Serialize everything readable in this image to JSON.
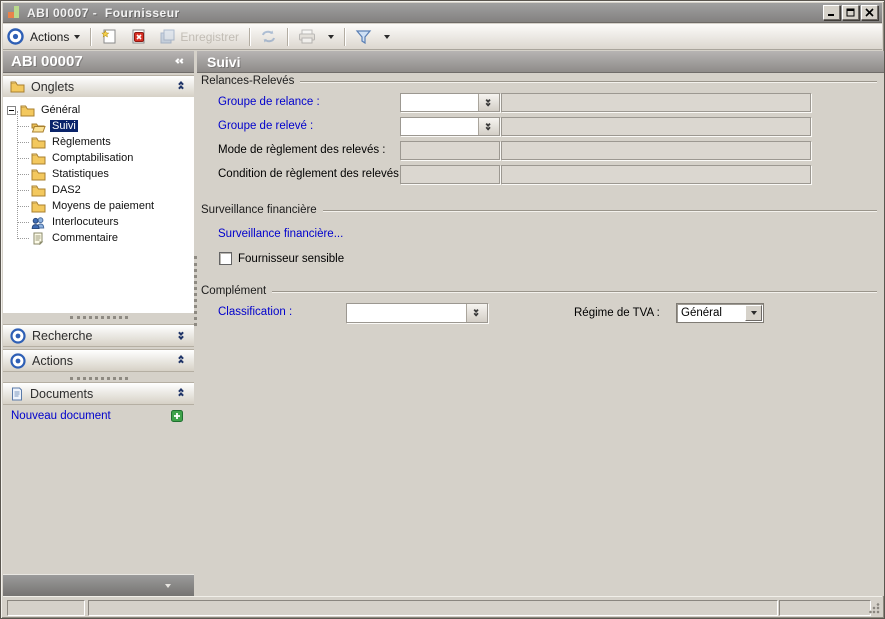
{
  "window": {
    "title": "ABI 00007 -  Fournisseur"
  },
  "toolbar": {
    "actions_label": "Actions",
    "save_label": "Enregistrer"
  },
  "sidebar": {
    "header": "ABI 00007",
    "sections": {
      "onglets": "Onglets",
      "recherche": "Recherche",
      "actions": "Actions",
      "documents": "Documents"
    },
    "tree": {
      "root": "Général",
      "items": [
        {
          "label": "Suivi",
          "selected": true
        },
        {
          "label": "Règlements"
        },
        {
          "label": "Comptabilisation"
        },
        {
          "label": "Statistiques"
        },
        {
          "label": "DAS2"
        },
        {
          "label": "Moyens de paiement"
        },
        {
          "label": "Interlocuteurs"
        },
        {
          "label": "Commentaire"
        }
      ]
    },
    "nouveau_document": "Nouveau document"
  },
  "main": {
    "title": "Suivi",
    "relances": {
      "title": "Relances-Relevés",
      "fields": [
        {
          "label": "Groupe de relance :",
          "value": "",
          "value2": ""
        },
        {
          "label": "Groupe de relevé :",
          "value": "",
          "value2": ""
        },
        {
          "label": "Mode de règlement des relevés :",
          "value": "",
          "value2": ""
        },
        {
          "label": "Condition de règlement des relevés :",
          "value": "",
          "value2": ""
        }
      ]
    },
    "surveillance": {
      "title": "Surveillance financière",
      "link": "Surveillance financière...",
      "checkbox_label": "Fournisseur sensible",
      "checkbox_checked": false
    },
    "complement": {
      "title": "Complément",
      "classification_label": "Classification :",
      "classification_value": "",
      "tva_label": "Régime de TVA :",
      "tva_value": "Général"
    }
  },
  "colors": {
    "selection": "#0a246a",
    "link_blue": "#0000cc",
    "titlebar_gray": "#8e8b89"
  }
}
